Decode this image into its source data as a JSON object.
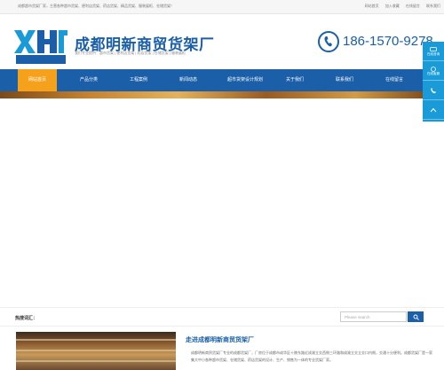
{
  "topbar": {
    "intro": "成都超市货架厂家，主营各种超市货架、便利店货架、药店货架、精品货架、服装展柜、仓储货架！",
    "links": [
      "网站首页",
      "加入收藏",
      "在线留言",
      "联系我们"
    ]
  },
  "header": {
    "logo_mark": "明新货架",
    "title": "成都明新商贸货架厂",
    "subtitle": "我们专业提供：超市货架 | 便利店货架 | 药店货架 | 仓储货架 | 服装展柜",
    "phone": "186-1570-9278"
  },
  "nav": {
    "items": [
      "网站首页",
      "产品分类",
      "工程案例",
      "新闻动态",
      "超市货架设计规划",
      "关于我们",
      "联系我们",
      "在线留言"
    ],
    "active_index": 0
  },
  "side_float": {
    "items": [
      "在线咨询",
      "在线客服",
      "电话",
      "返回顶部"
    ]
  },
  "keywords": {
    "label": "热搜词汇：",
    "search_placeholder": "Please search"
  },
  "about": {
    "title": "走进成都明新商贸货架厂",
    "text": "成都明新商贸货架厂专业的成都货架厂，厂房位于成都市成华区十陵东路近成渝立交西侧三环路和成渝立交立交口内侧，交通十分便利。成都货架厂是一家集大中小各种超市货架、仓储货架、药店货架的设计、生产、销售为一体的专业货架厂家。"
  },
  "colors": {
    "brand_blue": "#1a5fa8",
    "nav_active": "#f5a11c",
    "side_float": "#1a9bd7"
  }
}
